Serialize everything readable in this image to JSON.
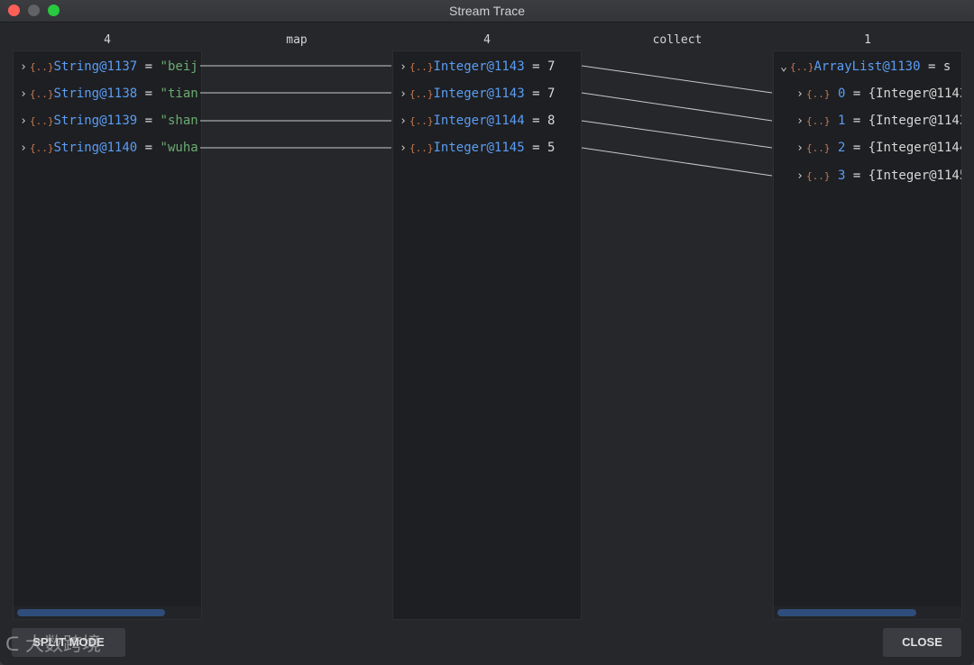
{
  "window": {
    "title": "Stream Trace"
  },
  "columns": [
    {
      "count": "4"
    },
    {
      "count": "4"
    },
    {
      "count": "1"
    }
  ],
  "operations": [
    "map",
    "collect"
  ],
  "left_panel": {
    "rows": [
      {
        "cls": "String@1137",
        "eq": "=",
        "val": "\"beij"
      },
      {
        "cls": "String@1138",
        "eq": "=",
        "val": "\"tian"
      },
      {
        "cls": "String@1139",
        "eq": "=",
        "val": "\"shan"
      },
      {
        "cls": "String@1140",
        "eq": "=",
        "val": "\"wuha"
      }
    ]
  },
  "middle_panel": {
    "rows": [
      {
        "cls": "Integer@1143",
        "eq": "=",
        "val": "7"
      },
      {
        "cls": "Integer@1143",
        "eq": "=",
        "val": "7"
      },
      {
        "cls": "Integer@1144",
        "eq": "=",
        "val": "8"
      },
      {
        "cls": "Integer@1145",
        "eq": "=",
        "val": "5"
      }
    ]
  },
  "right_panel": {
    "root": {
      "cls": "ArrayList@1130",
      "eq": "=",
      "val": "s"
    },
    "children": [
      {
        "idx": "0",
        "eq": "=",
        "val": "{Integer@1143"
      },
      {
        "idx": "1",
        "eq": "=",
        "val": "{Integer@1143"
      },
      {
        "idx": "2",
        "eq": "=",
        "val": "{Integer@1144"
      },
      {
        "idx": "3",
        "eq": "=",
        "val": "{Integer@1145"
      }
    ]
  },
  "buttons": {
    "split_mode": "SPLIT MODE",
    "close": "CLOSE"
  },
  "watermark": "大数跨境",
  "icons": {
    "object": "{..}",
    "expand": "›",
    "collapse": "⌄"
  },
  "colors": {
    "class_name": "#5a9df5",
    "string_value": "#6aab73",
    "object_icon": "#c77b52",
    "connector": "#c8c8c8"
  }
}
